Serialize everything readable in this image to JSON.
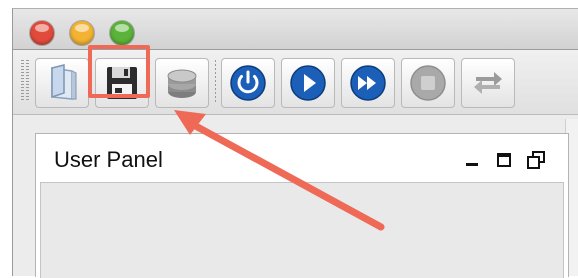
{
  "window": {
    "traffic_lights": [
      {
        "name": "close-light",
        "color": "#e24b3b"
      },
      {
        "name": "minimize-light",
        "color": "#f3b332"
      },
      {
        "name": "zoom-light",
        "color": "#5bb33a"
      }
    ]
  },
  "toolbar": {
    "buttons": [
      {
        "name": "open-button",
        "icon": "open-file-icon"
      },
      {
        "name": "save-button",
        "icon": "floppy-disk-icon",
        "highlighted": true
      },
      {
        "name": "database-button",
        "icon": "database-icon"
      },
      {
        "name": "power-button",
        "icon": "power-icon"
      },
      {
        "name": "play-button",
        "icon": "play-icon"
      },
      {
        "name": "fast-forward-button",
        "icon": "fast-forward-icon"
      },
      {
        "name": "stop-button",
        "icon": "stop-icon",
        "disabled": true
      },
      {
        "name": "swap-button",
        "icon": "swap-arrows-icon",
        "disabled": true
      }
    ]
  },
  "panel": {
    "title": "User Panel",
    "controls": [
      "minimize-icon",
      "maximize-icon",
      "restore-icon"
    ]
  },
  "annotation": {
    "arrow_color": "#ee6a57",
    "highlight_color": "#ee6a57"
  }
}
